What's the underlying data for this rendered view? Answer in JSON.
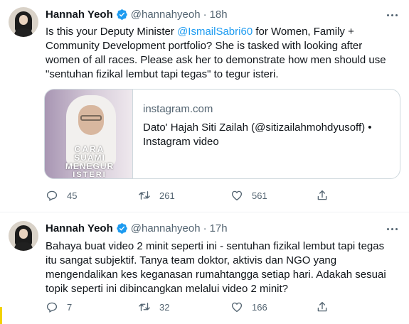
{
  "tweets": [
    {
      "author_name": "Hannah Yeoh",
      "handle": "@hannahyeoh",
      "separator": "·",
      "time": "18h",
      "text_before_mention": "Is this your Deputy Minister ",
      "mention": "@IsmailSabri60",
      "text_after_mention": " for Women, Family + Community Development portfolio? She is tasked with looking after women of all races. Please ask her to demonstrate how men should use \"sentuhan fizikal lembut tapi tegas\" to tegur isteri.",
      "card": {
        "domain": "instagram.com",
        "title": "Dato' Hajah Siti Zailah (@sitizailahmohdyusoff) •",
        "subtitle": "Instagram video",
        "thumb_text": [
          "CARA",
          "SUAMI",
          "MENEGUR",
          "ISTERI"
        ]
      },
      "replies": "45",
      "retweets": "261",
      "likes": "561"
    },
    {
      "author_name": "Hannah Yeoh",
      "handle": "@hannahyeoh",
      "separator": "·",
      "time": "17h",
      "text": "Bahaya buat video 2 minit seperti ini - sentuhan fizikal lembut tapi tegas itu sangat subjektif. Tanya team doktor, aktivis dan NGO yang mengendalikan kes keganasan rumahtangga setiap hari. Adakah sesuai topik seperti ini dibincangkan melalui video 2 minit?",
      "replies": "7",
      "retweets": "32",
      "likes": "166"
    }
  ],
  "colors": {
    "accent": "#1d9bf0",
    "text_primary": "#0f1419",
    "text_secondary": "#536471",
    "border": "#cfd9de"
  },
  "icons": {
    "verified": "verified-badge-icon",
    "more": "more-icon",
    "reply": "reply-icon",
    "retweet": "retweet-icon",
    "like": "like-icon",
    "share": "share-icon"
  }
}
